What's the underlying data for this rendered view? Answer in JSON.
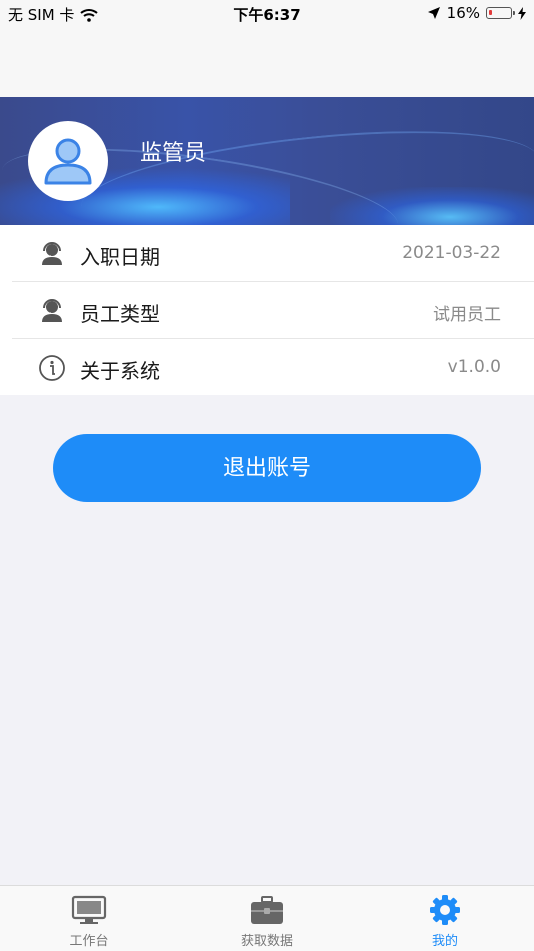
{
  "status_bar": {
    "carrier": "无 SIM 卡",
    "time": "下午6:37",
    "battery_percent": "16%",
    "battery_level": 0.16
  },
  "profile": {
    "name": "监管员"
  },
  "info_items": [
    {
      "label": "入职日期",
      "value": "2021-03-22",
      "icon": "headset-user-icon"
    },
    {
      "label": "员工类型",
      "value": "试用员工",
      "icon": "headset-user-icon"
    },
    {
      "label": "关于系统",
      "value": "v1.0.0",
      "icon": "info-icon"
    }
  ],
  "logout_label": "退出账号",
  "tabs": [
    {
      "label": "工作台",
      "icon": "monitor-icon",
      "active": false
    },
    {
      "label": "获取数据",
      "icon": "briefcase-icon",
      "active": false
    },
    {
      "label": "我的",
      "icon": "gear-icon",
      "active": true
    }
  ],
  "colors": {
    "accent": "#1e8cf8",
    "banner": "#3953a8",
    "background": "#f2f2f7"
  }
}
